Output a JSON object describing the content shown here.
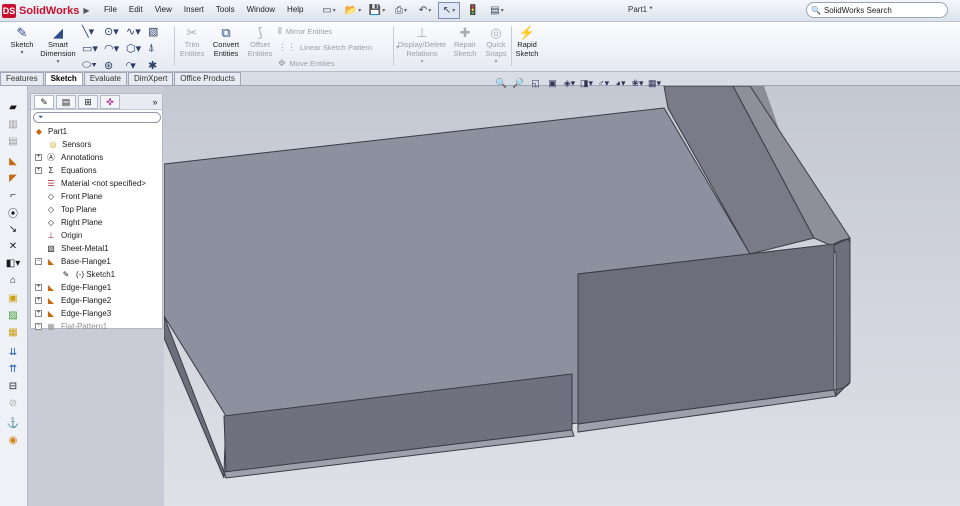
{
  "app": {
    "logo_text": "SolidWorks",
    "doc_title": "Part1 *"
  },
  "menu": [
    "File",
    "Edit",
    "View",
    "Insert",
    "Tools",
    "Window",
    "Help"
  ],
  "search": {
    "placeholder": "SolidWorks Search"
  },
  "ribbon": {
    "sketch": {
      "label": "Sketch"
    },
    "smart_dimension": {
      "label1": "Smart",
      "label2": "Dimension"
    },
    "trim": {
      "label1": "Trim",
      "label2": "Entities"
    },
    "convert": {
      "label1": "Convert",
      "label2": "Entities"
    },
    "offset": {
      "label1": "Offset",
      "label2": "Entities"
    },
    "mirror": {
      "label": "Mirror Entities"
    },
    "linear_pattern": {
      "label": "Linear Sketch Pattern"
    },
    "move": {
      "label": "Move Entities"
    },
    "display_delete": {
      "label1": "Display/Delete",
      "label2": "Relations"
    },
    "repair": {
      "label1": "Repair",
      "label2": "Sketch"
    },
    "quick_snaps": {
      "label1": "Quick",
      "label2": "Snaps"
    },
    "rapid_sketch": {
      "label1": "Rapid",
      "label2": "Sketch"
    }
  },
  "tabs": [
    {
      "label": "Features",
      "active": false
    },
    {
      "label": "Sketch",
      "active": true
    },
    {
      "label": "Evaluate",
      "active": false
    },
    {
      "label": "DimXpert",
      "active": false
    },
    {
      "label": "Office Products",
      "active": false
    }
  ],
  "feature_tree": {
    "root": "Part1",
    "items": [
      {
        "label": "Sensors",
        "icon": "sensor-icon"
      },
      {
        "label": "Annotations",
        "icon": "annotation-icon"
      },
      {
        "label": "Equations",
        "icon": "sigma-icon"
      },
      {
        "label": "Material <not specified>",
        "icon": "material-icon"
      },
      {
        "label": "Front Plane",
        "icon": "plane-icon"
      },
      {
        "label": "Top Plane",
        "icon": "plane-icon"
      },
      {
        "label": "Right Plane",
        "icon": "plane-icon"
      },
      {
        "label": "Origin",
        "icon": "origin-icon"
      },
      {
        "label": "Sheet-Metal1",
        "icon": "sheet-metal-icon"
      },
      {
        "label": "Base-Flange1",
        "icon": "base-flange-icon"
      },
      {
        "label": "(-) Sketch1",
        "icon": "sketch-icon"
      },
      {
        "label": "Edge-Flange1",
        "icon": "edge-flange-icon"
      },
      {
        "label": "Edge-Flange2",
        "icon": "edge-flange-icon"
      },
      {
        "label": "Edge-Flange3",
        "icon": "edge-flange-icon"
      },
      {
        "label": "Flat-Pattern1",
        "icon": "flat-pattern-icon"
      }
    ]
  }
}
